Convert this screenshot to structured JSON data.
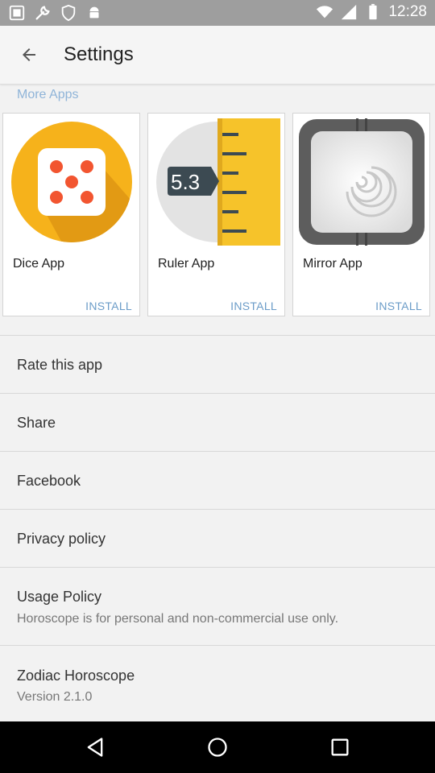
{
  "status_bar": {
    "time": "12:28"
  },
  "app_bar": {
    "title": "Settings"
  },
  "more_apps": {
    "header": "More Apps",
    "apps": [
      {
        "name": "Dice App",
        "action": "INSTALL",
        "icon": "dice-icon"
      },
      {
        "name": "Ruler App",
        "action": "INSTALL",
        "icon": "ruler-icon",
        "icon_text": "5.3"
      },
      {
        "name": "Mirror App",
        "action": "INSTALL",
        "icon": "mirror-icon"
      }
    ]
  },
  "settings": [
    {
      "title": "Rate this app"
    },
    {
      "title": "Share"
    },
    {
      "title": "Facebook"
    },
    {
      "title": "Privacy policy"
    },
    {
      "title": "Usage Policy",
      "subtitle": "Horoscope is for personal and non-commercial use only."
    },
    {
      "title": "Zodiac Horoscope",
      "subtitle": "Version 2.1.0"
    }
  ],
  "colors": {
    "accent": "#6b9cc8",
    "section_header": "#8fb4d8",
    "status_bar": "#9e9e9e"
  }
}
